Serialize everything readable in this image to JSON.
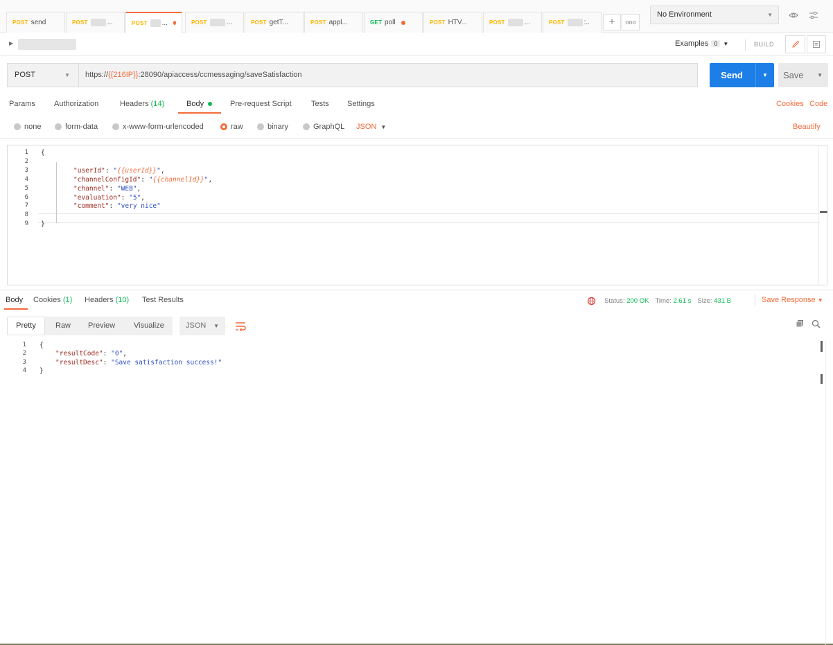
{
  "tabs": [
    {
      "method": "POST",
      "name": "send",
      "blurred": false,
      "dot": false,
      "active": false
    },
    {
      "method": "POST",
      "name": "...",
      "blurred": true,
      "dot": false,
      "active": false
    },
    {
      "method": "POST",
      "name": "...",
      "blurred": true,
      "dot": true,
      "active": true
    },
    {
      "method": "POST",
      "name": "...",
      "blurred": true,
      "dot": false,
      "active": false
    },
    {
      "method": "POST",
      "name": "getT...",
      "blurred": false,
      "dot": false,
      "active": false
    },
    {
      "method": "POST",
      "name": "appl...",
      "blurred": false,
      "dot": false,
      "active": false
    },
    {
      "method": "GET",
      "name": "poll",
      "blurred": false,
      "dot": true,
      "active": false
    },
    {
      "method": "POST",
      "name": "HTV...",
      "blurred": false,
      "dot": false,
      "active": false
    },
    {
      "method": "POST",
      "name": "...",
      "blurred": true,
      "dot": false,
      "active": false
    },
    {
      "method": "POST",
      "name": ":..",
      "blurred": true,
      "dot": false,
      "active": false
    }
  ],
  "tabbar": {
    "add": "+",
    "more": "ooo"
  },
  "environment": {
    "selected": "No Environment"
  },
  "toolbar": {
    "examples_label": "Examples",
    "examples_count": "0",
    "build_label": "BUILD"
  },
  "request": {
    "method": "POST",
    "url_prefix": "https://",
    "url_variable": "{{216IP}}",
    "url_suffix": ":28090/apiaccess/ccmessaging/saveSatisfaction",
    "send_label": "Send",
    "save_label": "Save"
  },
  "request_tabs": {
    "params": "Params",
    "authorization": "Authorization",
    "headers": "Headers",
    "headers_count": "(14)",
    "body": "Body",
    "prerequest": "Pre-request Script",
    "tests": "Tests",
    "settings": "Settings",
    "cookies_link": "Cookies",
    "code_link": "Code"
  },
  "body_options": {
    "none": "none",
    "form_data": "form-data",
    "urlencoded": "x-www-form-urlencoded",
    "raw": "raw",
    "binary": "binary",
    "graphql": "GraphQL",
    "format": "JSON",
    "beautify": "Beautify"
  },
  "request_body": {
    "line_numbers": [
      "1",
      "2",
      "3",
      "4",
      "5",
      "6",
      "7",
      "8",
      "9"
    ],
    "open_brace": "{",
    "close_brace": "}",
    "fields": [
      {
        "key": "\"userId\"",
        "value": "{{userId}}",
        "is_variable": true,
        "comma": ","
      },
      {
        "key": "\"channelConfigId\"",
        "value": "{{channelId}}",
        "is_variable": true,
        "comma": ","
      },
      {
        "key": "\"channel\"",
        "value": "\"WEB\"",
        "is_variable": false,
        "comma": ","
      },
      {
        "key": "\"evaluation\"",
        "value": "\"5\"",
        "is_variable": false,
        "comma": ","
      },
      {
        "key": "\"comment\"",
        "value": "\"very nice\"",
        "is_variable": false,
        "comma": ""
      }
    ]
  },
  "response_tabs": {
    "body": "Body",
    "cookies": "Cookies",
    "cookies_count": "(1)",
    "headers": "Headers",
    "headers_count": "(10)",
    "test_results": "Test Results"
  },
  "response_status": {
    "status_label": "Status:",
    "status_value": "200 OK",
    "time_label": "Time:",
    "time_value": "2.61 s",
    "size_label": "Size:",
    "size_value": "431 B",
    "save_response": "Save Response"
  },
  "response_view": {
    "pretty": "Pretty",
    "raw": "Raw",
    "preview": "Preview",
    "visualize": "Visualize",
    "format": "JSON"
  },
  "response_body": {
    "line_numbers": [
      "1",
      "2",
      "3",
      "4"
    ],
    "open_brace": "{",
    "close_brace": "}",
    "fields": [
      {
        "key": "\"resultCode\"",
        "value": "\"0\"",
        "comma": ","
      },
      {
        "key": "\"resultDesc\"",
        "value": "\"Save satisfaction success!\"",
        "comma": ""
      }
    ]
  },
  "colors": {
    "accent": "#f26b3a",
    "send_blue": "#1c7ee6",
    "success_green": "#0cbb52",
    "post_method": "#ffb400"
  },
  "icons": [
    "eye-icon",
    "sliders-icon",
    "pencil-icon",
    "comment-icon",
    "globe-icon",
    "copy-icon",
    "search-icon",
    "wrap-lines-icon",
    "chevron-down-icon",
    "caret-right-icon"
  ]
}
